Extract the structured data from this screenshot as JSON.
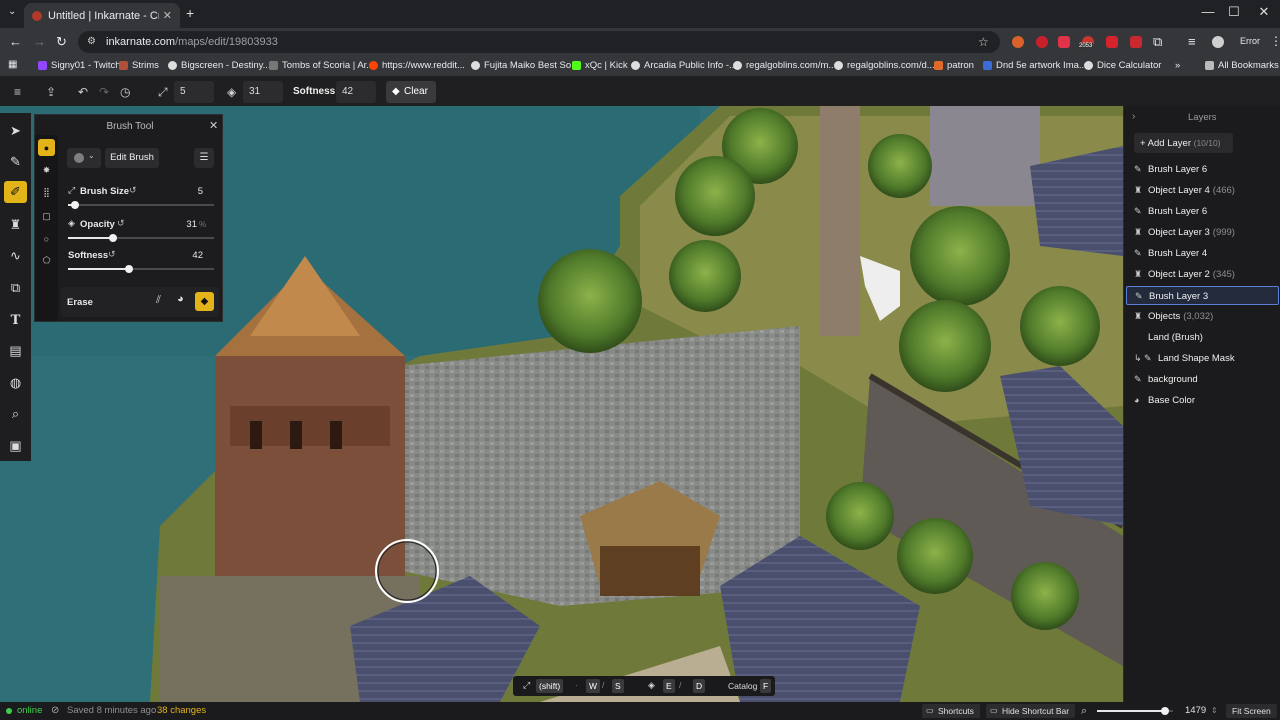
{
  "browser": {
    "tab_title": "Untitled | Inkarnate - Create Fa",
    "url_domain": "inkarnate.com",
    "url_path": "/maps/edit/19803933",
    "error_label": "Error",
    "badge_count": "2053",
    "bookmarks": [
      "Signy01 - Twitch",
      "Strims",
      "Bigscreen - Destiny...",
      "Tombs of Scoria | Ar...",
      "https://www.reddit...",
      "Fujita Maiko Best So...",
      "xQc | Kick",
      "Arcadia Public Info -...",
      "regalgoblins.com/m...",
      "regalgoblins.com/d...",
      "patron",
      "Dnd 5e artwork Ima...",
      "Dice Calculator"
    ],
    "all_bookmarks": "All Bookmarks",
    "more": "»"
  },
  "toolbar": {
    "size_value": "5",
    "opacity_value": "31",
    "softness_label": "Softness:",
    "softness_value": "42",
    "clear_label": "Clear"
  },
  "brush_panel": {
    "title": "Brush Tool",
    "edit_brush": "Edit Brush",
    "brush_size_label": "Brush Size",
    "brush_size_value": "5",
    "brush_size_fraction": 0.05,
    "opacity_label": "Opacity",
    "opacity_value": "31",
    "opacity_unit": "%",
    "opacity_fraction": 0.31,
    "softness_label": "Softness",
    "softness_value": "42",
    "softness_fraction": 0.42,
    "erase_label": "Erase"
  },
  "layers": {
    "title": "Layers",
    "add_layer": "Add Layer",
    "add_count": "(10/10)",
    "items": [
      {
        "name": "Brush Layer 6",
        "count": "",
        "icon": "brush-icon",
        "selected": false
      },
      {
        "name": "Object Layer 4",
        "count": "(466)",
        "icon": "tower-icon",
        "selected": false
      },
      {
        "name": "Brush Layer 6",
        "count": "",
        "icon": "brush-icon",
        "selected": false
      },
      {
        "name": "Object Layer 3",
        "count": "(999)",
        "icon": "tower-icon",
        "selected": false
      },
      {
        "name": "Brush Layer 4",
        "count": "",
        "icon": "brush-icon",
        "selected": false
      },
      {
        "name": "Object Layer 2",
        "count": "(345)",
        "icon": "tower-icon",
        "selected": false
      },
      {
        "name": "Brush Layer 3",
        "count": "",
        "icon": "brush-icon",
        "selected": true
      },
      {
        "name": "Objects",
        "count": "(3,032)",
        "icon": "tower-icon",
        "selected": false
      },
      {
        "name": "Land (Brush)",
        "count": "",
        "icon": "",
        "selected": false
      },
      {
        "name": "Land Shape Mask",
        "count": "",
        "icon": "mask-icon",
        "selected": false
      },
      {
        "name": "background",
        "count": "",
        "icon": "brush-icon",
        "selected": false
      },
      {
        "name": "Base Color",
        "count": "",
        "icon": "palette-icon",
        "selected": false
      }
    ]
  },
  "shortcut_bar": {
    "shift": "(shift)",
    "w": "W",
    "slash": "/",
    "s": "S",
    "e": "E",
    "d": "D",
    "catalog": "Catalog",
    "f": "F"
  },
  "status": {
    "online": "online",
    "saved": "Saved 8 minutes ago",
    "changes": "38 changes",
    "shortcuts": "Shortcuts",
    "hide_shortcut_bar": "Hide Shortcut Bar",
    "zoom": "1479",
    "zoom_fraction": 0.9,
    "fit_screen": "Fit Screen"
  },
  "colors": {
    "accent": "#e3b41a",
    "selection": "#5b7fd6",
    "water": "#2c6b74",
    "changes": "#e3b41a",
    "online": "#3ccf4e"
  }
}
